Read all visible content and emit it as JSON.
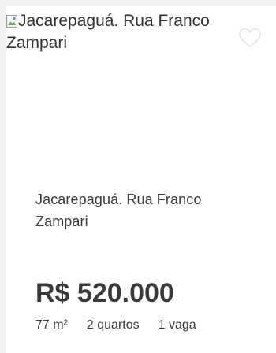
{
  "listing": {
    "image_alt": "Jacarepaguá. Rua Franco Zampari",
    "favorite_icon": "heart-outline-icon",
    "title": "Jacarepaguá. Rua Franco Zampari",
    "price": "R$ 520.000",
    "features": {
      "area": "77 m²",
      "bedrooms": "2 quartos",
      "parking": "1 vaga"
    }
  }
}
